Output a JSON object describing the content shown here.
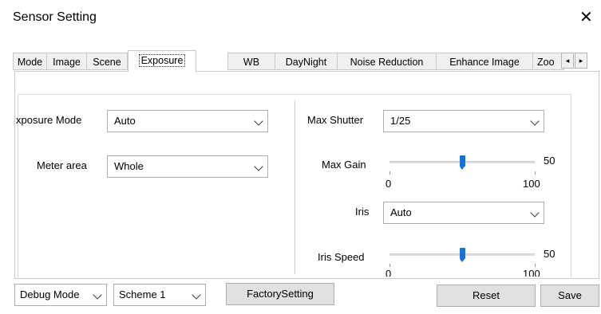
{
  "window": {
    "title": "Sensor Setting",
    "close_glyph": "✕"
  },
  "tabs": [
    {
      "label": "Mode"
    },
    {
      "label": "Image"
    },
    {
      "label": "Scene"
    },
    {
      "label": "Exposure"
    },
    {
      "label": "WB"
    },
    {
      "label": "DayNight"
    },
    {
      "label": "Noise Reduction"
    },
    {
      "label": "Enhance Image"
    },
    {
      "label": "Zoo"
    }
  ],
  "tab_scroll": {
    "left": "◂",
    "right": "▸"
  },
  "exposure": {
    "exposure_mode_label": "xposure Mode",
    "exposure_mode_value": "Auto",
    "meter_area_label": "Meter area",
    "meter_area_value": "Whole",
    "max_shutter_label": "Max Shutter",
    "max_shutter_value": "1/25",
    "max_gain_label": "Max Gain",
    "max_gain_value": "50",
    "max_gain_min": "0",
    "max_gain_max": "100",
    "max_gain_fraction": 0.5,
    "iris_label": "Iris",
    "iris_value": "Auto",
    "iris_speed_label": "Iris Speed",
    "iris_speed_value": "50",
    "iris_speed_min": "0",
    "iris_speed_max": "100",
    "iris_speed_fraction": 0.5
  },
  "footer": {
    "debug_mode": "Debug Mode",
    "scheme": "Scheme 1",
    "factory_setting": "FactorySetting",
    "reset": "Reset",
    "save": "Save"
  }
}
